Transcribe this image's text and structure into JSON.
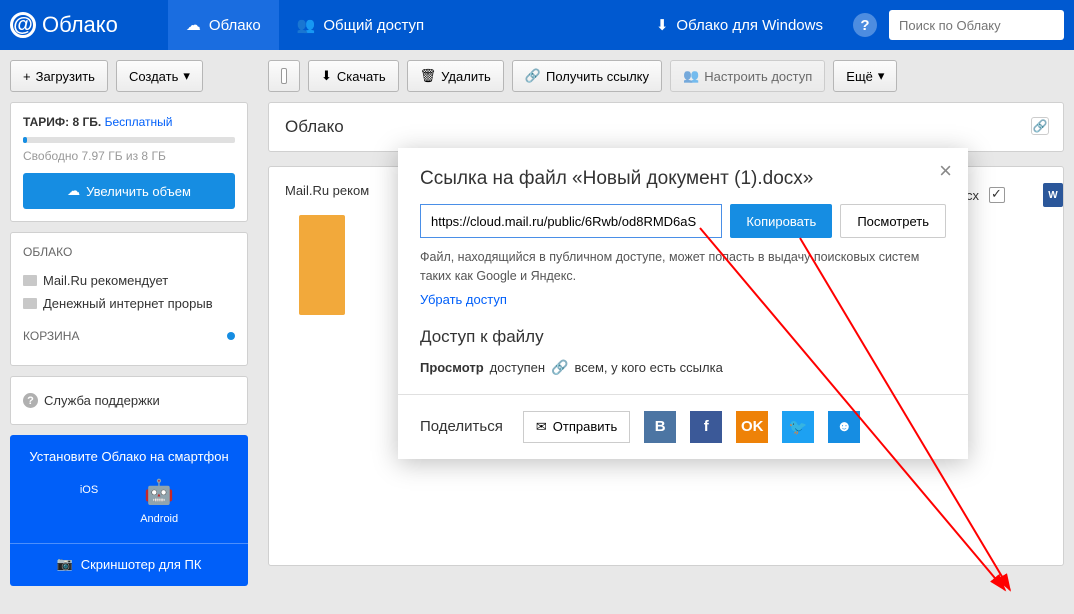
{
  "header": {
    "logo": "Облако",
    "tab_cloud": "Облако",
    "tab_shared": "Общий доступ",
    "windows_link": "Облако для Windows",
    "search_placeholder": "Поиск по Облаку"
  },
  "sidebar": {
    "upload": "Загрузить",
    "create": "Создать",
    "tariff_label": "ТАРИФ: 8 ГБ.",
    "tariff_plan": "Бесплатный",
    "free_space": "Свободно 7.97 ГБ из 8 ГБ",
    "increase": "Увеличить объем",
    "cloud_h": "ОБЛАКО",
    "items": [
      {
        "label": "Mail.Ru рекомендует"
      },
      {
        "label": "Денежный интернет прорыв"
      }
    ],
    "trash_h": "КОРЗИНА",
    "support": "Служба поддержки",
    "promo_title": "Установите Облако на смартфон",
    "promo_ios": "iOS",
    "promo_android": "Android",
    "promo_screenshoter": "Скриншотер для ПК"
  },
  "toolbar": {
    "download": "Скачать",
    "delete": "Удалить",
    "getlink": "Получить ссылку",
    "access": "Настроить доступ",
    "more": "Ещё"
  },
  "content": {
    "breadcrumb": "Облако",
    "recom": "Mail.Ru реком",
    "file_ext": ".docx"
  },
  "modal": {
    "title": "Ссылка на файл «Новый документ (1).docx»",
    "url": "https://cloud.mail.ru/public/6Rwb/od8RMD6aS",
    "copy": "Копировать",
    "view": "Посмотреть",
    "note": "Файл, находящийся в публичном доступе, может попасть в выдачу поисковых систем таких как Google и Яндекс.",
    "remove": "Убрать доступ",
    "access_h": "Доступ к файлу",
    "access_label": "Просмотр",
    "access_state": "доступен",
    "access_who": "всем, у кого есть ссылка",
    "share": "Поделиться",
    "send": "Отправить"
  }
}
